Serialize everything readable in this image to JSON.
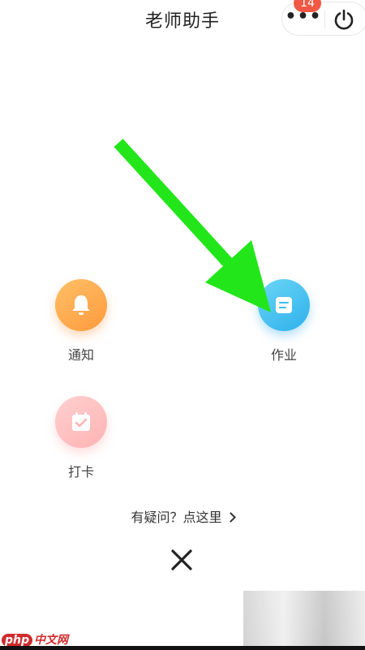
{
  "header": {
    "title": "老师助手",
    "more_dots": "•••",
    "badge_count": "14"
  },
  "grid": {
    "items": [
      {
        "label": "通知",
        "icon": "bell-icon",
        "color": "#ffa94a"
      },
      {
        "label": "作业",
        "icon": "homework-icon",
        "color": "#3dbdf0"
      },
      {
        "label": "打卡",
        "icon": "calendar-check-icon",
        "color": "#ffbdbd"
      }
    ]
  },
  "help": {
    "text": "有疑问？点这里"
  },
  "annotation": {
    "arrow_color": "#22e61a"
  },
  "watermark": {
    "brand": "php",
    "suffix": "中文网"
  }
}
